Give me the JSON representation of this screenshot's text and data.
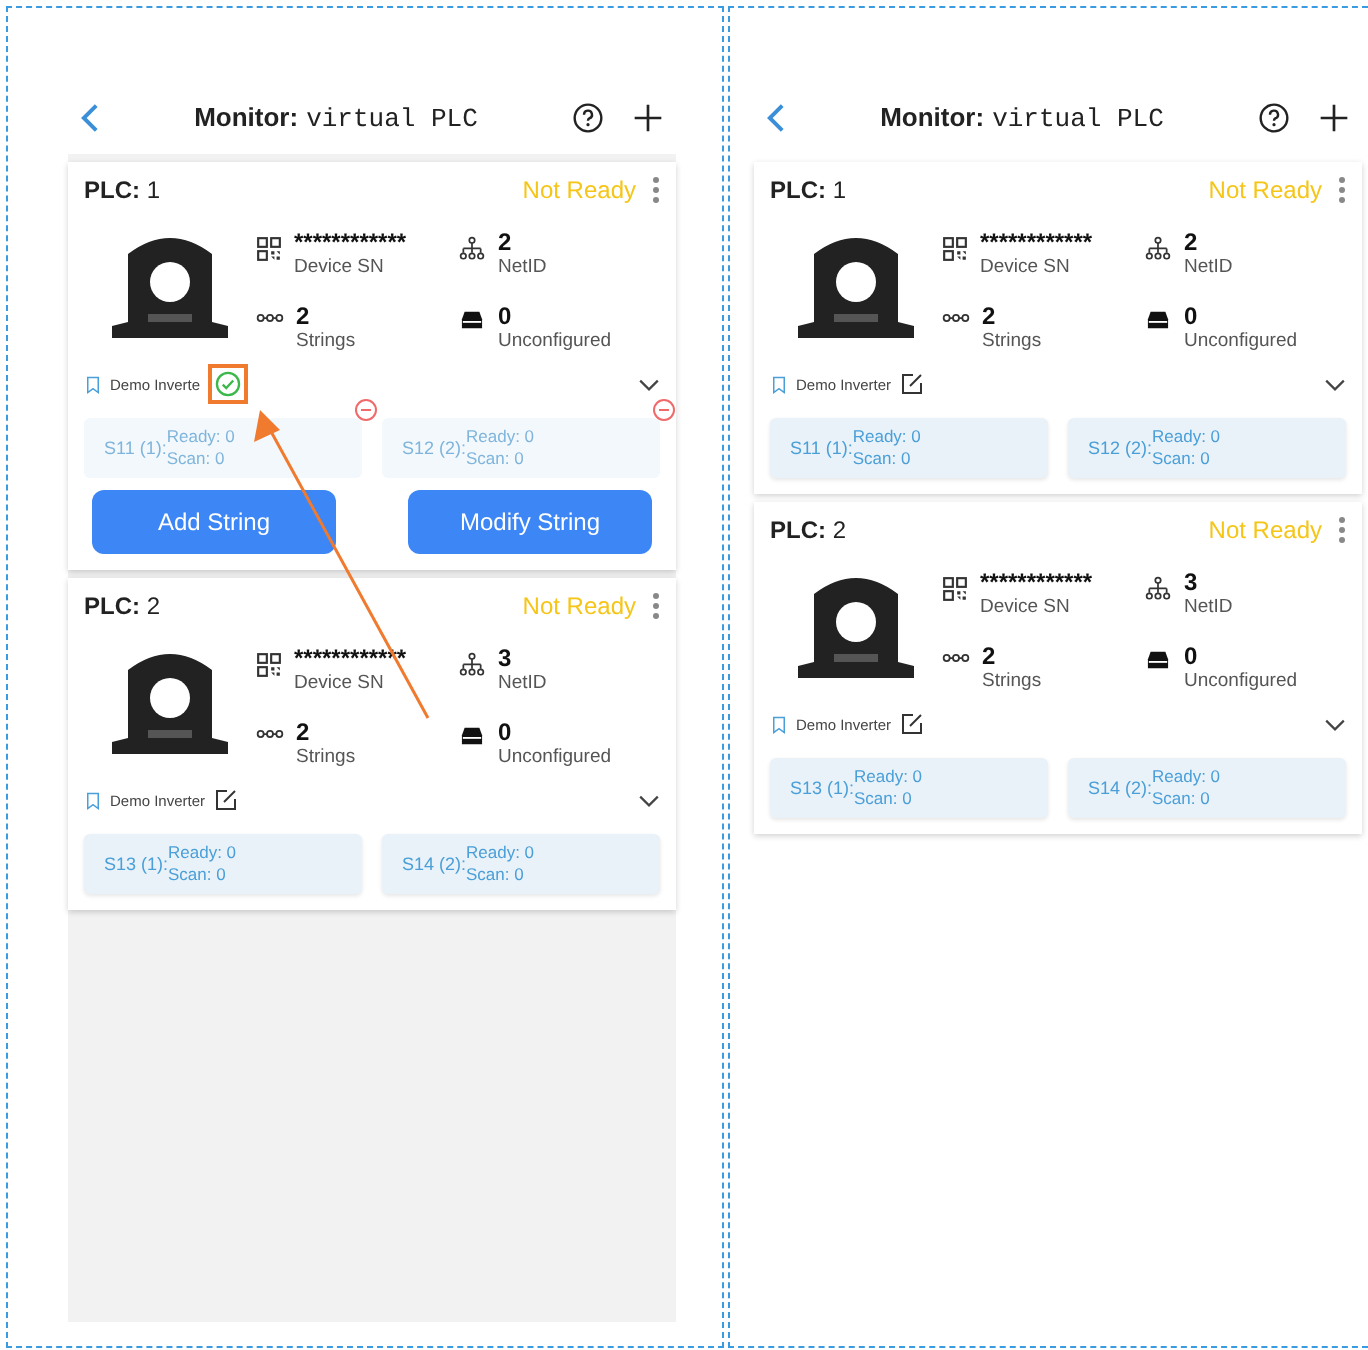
{
  "panels": [
    {
      "title_label": "Monitor:",
      "title_value": "virtual PLC",
      "filled_background": true,
      "callout_arrow": true,
      "plcs": [
        {
          "label": "PLC:",
          "number": "1",
          "status": "Not Ready",
          "sn": "************",
          "sn_label": "Device SN",
          "netid": "2",
          "netid_label": "NetID",
          "strings": "2",
          "strings_label": "Strings",
          "unconfigured": "0",
          "unconfigured_label": "Unconfigured",
          "name": "Demo Inverte",
          "editing": true,
          "highlight": true,
          "chips": [
            {
              "name": "S11 (1):",
              "ready": "Ready: 0",
              "scan": "Scan: 0"
            },
            {
              "name": "S12 (2):",
              "ready": "Ready: 0",
              "scan": "Scan: 0"
            }
          ],
          "buttons": [
            "Add String",
            "Modify String"
          ]
        },
        {
          "label": "PLC:",
          "number": "2",
          "status": "Not Ready",
          "sn": "************",
          "sn_label": "Device SN",
          "netid": "3",
          "netid_label": "NetID",
          "strings": "2",
          "strings_label": "Strings",
          "unconfigured": "0",
          "unconfigured_label": "Unconfigured",
          "name": "Demo Inverter",
          "editing": false,
          "highlight": false,
          "chips": [
            {
              "name": "S13 (1):",
              "ready": "Ready: 0",
              "scan": "Scan: 0"
            },
            {
              "name": "S14 (2):",
              "ready": "Ready: 0",
              "scan": "Scan: 0"
            }
          ]
        }
      ]
    },
    {
      "title_label": "Monitor:",
      "title_value": "virtual PLC",
      "filled_background": false,
      "callout_arrow": false,
      "plcs": [
        {
          "label": "PLC:",
          "number": "1",
          "status": "Not Ready",
          "sn": "************",
          "sn_label": "Device SN",
          "netid": "2",
          "netid_label": "NetID",
          "strings": "2",
          "strings_label": "Strings",
          "unconfigured": "0",
          "unconfigured_label": "Unconfigured",
          "name": "Demo Inverter",
          "editing": false,
          "highlight": false,
          "chips": [
            {
              "name": "S11 (1):",
              "ready": "Ready: 0",
              "scan": "Scan: 0"
            },
            {
              "name": "S12 (2):",
              "ready": "Ready: 0",
              "scan": "Scan: 0"
            }
          ]
        },
        {
          "label": "PLC:",
          "number": "2",
          "status": "Not Ready",
          "sn": "************",
          "sn_label": "Device SN",
          "netid": "3",
          "netid_label": "NetID",
          "strings": "2",
          "strings_label": "Strings",
          "unconfigured": "0",
          "unconfigured_label": "Unconfigured",
          "name": "Demo Inverter",
          "editing": false,
          "highlight": false,
          "chips": [
            {
              "name": "S13 (1):",
              "ready": "Ready: 0",
              "scan": "Scan: 0"
            },
            {
              "name": "S14 (2):",
              "ready": "Ready: 0",
              "scan": "Scan: 0"
            }
          ]
        }
      ]
    }
  ]
}
